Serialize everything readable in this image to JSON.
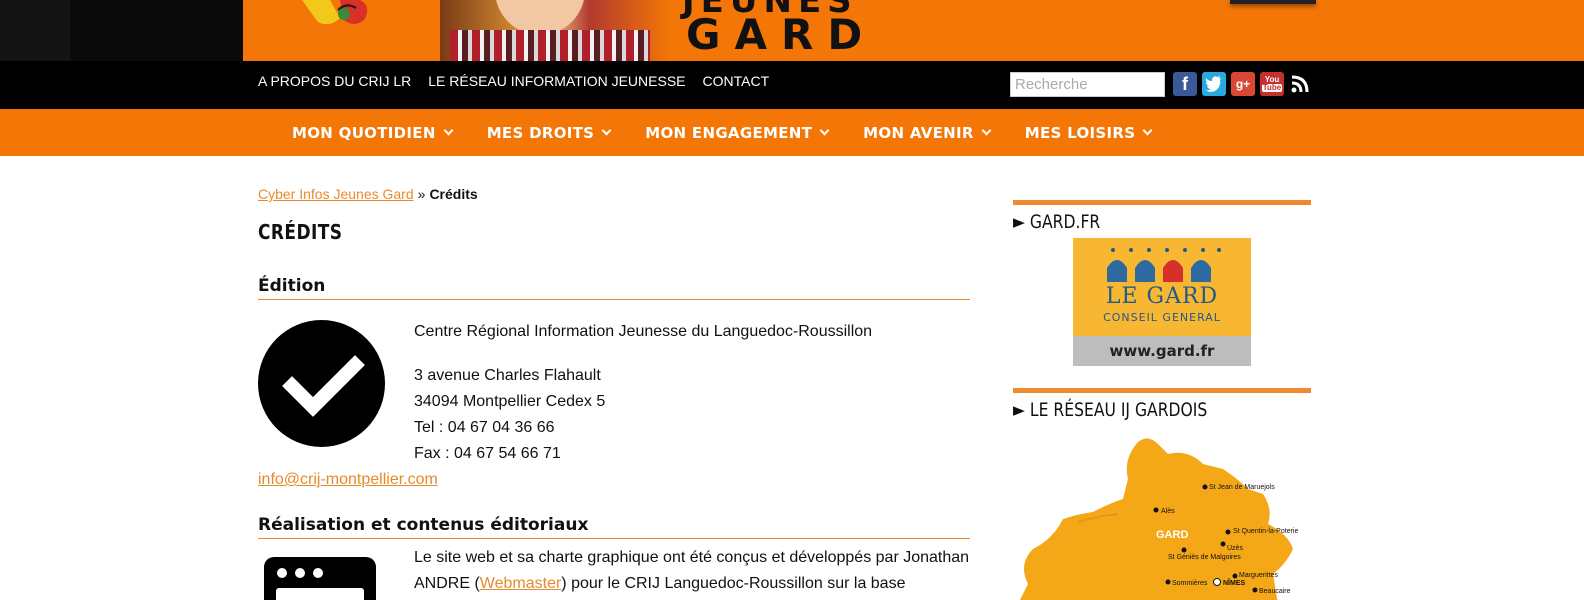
{
  "banner": {
    "title_top": "JEUNES",
    "title": "GARD"
  },
  "topnav": {
    "links": [
      "A PROPOS DU CRIJ LR",
      "LE RÉSEAU INFORMATION JEUNESSE",
      "CONTACT"
    ],
    "search_placeholder": "Recherche",
    "social_icons": [
      "facebook-icon",
      "twitter-icon",
      "google-plus-icon",
      "youtube-icon",
      "rss-icon"
    ]
  },
  "mainnav": {
    "items": [
      "MON QUOTIDIEN",
      "MES DROITS",
      "MON ENGAGEMENT",
      "MON AVENIR",
      "MES LOISIRS"
    ]
  },
  "breadcrumb": {
    "home": "Cyber Infos Jeunes Gard",
    "separator": "»",
    "current": "Crédits"
  },
  "page": {
    "title": "CRÉDITS",
    "edition": {
      "heading": "Édition",
      "org": "Centre Régional Information Jeunesse du Languedoc-Roussillon",
      "address_line1": "3 avenue Charles Flahault",
      "address_line2": "34094 Montpellier Cedex 5",
      "tel": "Tel : 04 67 04 36 66",
      "fax": "Fax : 04 67 54 66 71",
      "email": "info@crij-montpellier.com"
    },
    "realisation": {
      "heading": "Réalisation et contenus éditoriaux",
      "text_before": "Le site web et sa charte graphique ont été conçus et développés par Jonathan ANDRE (",
      "link": "Webmaster",
      "text_after": ") pour le CRIJ Languedoc-Roussillon sur la base"
    }
  },
  "sidebar": {
    "widget1_title": "► GARD.FR",
    "gard_logo": {
      "name": "LE GARD",
      "sub": "CONSEIL GENERAL",
      "url": "www.gard.fr"
    },
    "widget2_title": "► LE RÉSEAU IJ GARDOIS",
    "map": {
      "region": "GARD",
      "cities": [
        "St Jean de Maruejols",
        "Alès",
        "St Quentin-la-Poterie",
        "Uzès",
        "St Géniès de Malgoires",
        "Marguerittes",
        "Sommières",
        "NÎMES",
        "Beaucaire"
      ]
    }
  },
  "colors": {
    "accent_orange": "#f37607",
    "link_orange": "#e88a2c",
    "nav_black": "#000000"
  }
}
